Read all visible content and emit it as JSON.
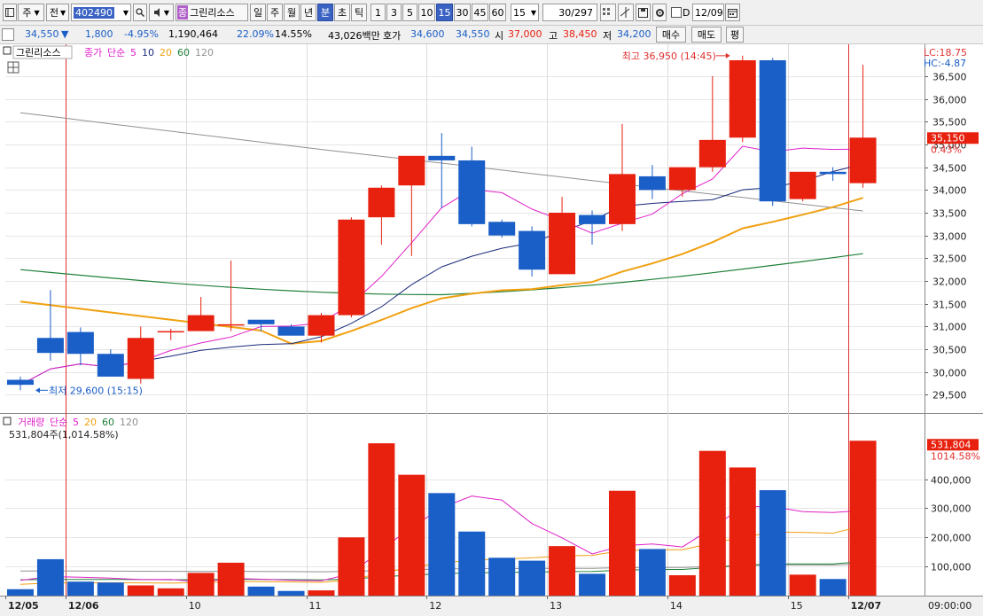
{
  "toolbar": {
    "btn_ju": "주",
    "btn_jeon": "전",
    "code_value": "402490",
    "stock_name": "그린리소스",
    "period_buttons": [
      "일",
      "주",
      "월",
      "년",
      "분",
      "초",
      "틱"
    ],
    "interval_buttons": [
      "1",
      "3",
      "5",
      "10",
      "15",
      "30",
      "45",
      "60"
    ],
    "interval_select": "15",
    "count": "30",
    "count_total": "/297",
    "d_label": "D",
    "date_value": "12/09"
  },
  "quote": {
    "price": "34,550",
    "arrow": "▼",
    "change": "1,800",
    "change_pct": "-4.95%",
    "volume": "1,190,464",
    "vol_ratio": "22.09%",
    "turnover": "14.55%",
    "amount": "43,026백만",
    "hoga_label": "호가",
    "ask": "34,600",
    "bid": "34,550",
    "open_label": "시",
    "open": "37,000",
    "high_label": "고",
    "high": "38,450",
    "low_label": "저",
    "low": "34,200",
    "buy_button": "매수",
    "sell_button": "매도",
    "eval_button": "평"
  },
  "colors": {
    "up": "#e8200e",
    "down": "#1a5ec8",
    "ma5": "#e020c8",
    "ma10": "#1a2a7a",
    "ma20": "#f0a010",
    "ma60": "#20803a",
    "ma120": "#909090"
  },
  "price_panel": {
    "legend_name": "그린리소스",
    "legend_items": [
      {
        "label": "종가",
        "color": "#e020c8"
      },
      {
        "label": "단순",
        "color": "#e020c8"
      },
      {
        "label": "5",
        "color": "#e020c8"
      },
      {
        "label": "10",
        "color": "#1a2a7a"
      },
      {
        "label": "20",
        "color": "#f0a010"
      },
      {
        "label": "60",
        "color": "#20803a"
      },
      {
        "label": "120",
        "color": "#909090"
      }
    ],
    "lc_label": "LC:18.75",
    "hc_label": "HC:-4.87",
    "high_annotation": "최고 36,950 (14:45)",
    "low_annotation": "최저 29,600 (15:15)",
    "current_price_tag": "35,150",
    "current_pct_tag": "0.43%"
  },
  "volume_panel": {
    "legend_items": [
      {
        "label": "거래량",
        "color": "#e020c8"
      },
      {
        "label": "단순",
        "color": "#e020c8"
      },
      {
        "label": "5",
        "color": "#e020c8"
      },
      {
        "label": "20",
        "color": "#f0a010"
      },
      {
        "label": "60",
        "color": "#20803a"
      },
      {
        "label": "120",
        "color": "#909090"
      }
    ],
    "current_text": "531,804주(1,014.58%)",
    "current_tag": "531,804",
    "current_pct_tag": "1014.58%"
  },
  "chart_data": {
    "type": "candlestick",
    "price_yticks": [
      29500,
      30000,
      30500,
      31000,
      31500,
      32000,
      32500,
      33000,
      33500,
      34000,
      34500,
      35000,
      35500,
      36000,
      36500
    ],
    "price_ylim": [
      29100,
      37200
    ],
    "volume_yticks": [
      100000,
      200000,
      300000,
      400000
    ],
    "volume_ylim": [
      0,
      560000
    ],
    "x_labels": [
      "12/05",
      "12/06",
      "10",
      "11",
      "12",
      "13",
      "14",
      "15",
      "12/07",
      "09:00:00"
    ],
    "candles": [
      {
        "o": 29830,
        "h": 29900,
        "l": 29600,
        "c": 29720,
        "v": 22000
      },
      {
        "o": 30750,
        "h": 31800,
        "l": 30250,
        "c": 30420,
        "v": 125000
      },
      {
        "o": 30880,
        "h": 30980,
        "l": 30150,
        "c": 30400,
        "v": 48000
      },
      {
        "o": 30400,
        "h": 30500,
        "l": 29900,
        "c": 29900,
        "v": 45000
      },
      {
        "o": 29850,
        "h": 31000,
        "l": 29750,
        "c": 30750,
        "v": 35000
      },
      {
        "o": 30900,
        "h": 30950,
        "l": 30700,
        "c": 30900,
        "v": 25000
      },
      {
        "o": 30900,
        "h": 31650,
        "l": 30900,
        "c": 31250,
        "v": 78000
      },
      {
        "o": 31050,
        "h": 32450,
        "l": 30900,
        "c": 31050,
        "v": 113000
      },
      {
        "o": 31150,
        "h": 31150,
        "l": 30900,
        "c": 31050,
        "v": 31000
      },
      {
        "o": 31000,
        "h": 31050,
        "l": 30800,
        "c": 30800,
        "v": 16000
      },
      {
        "o": 30800,
        "h": 31300,
        "l": 30650,
        "c": 31250,
        "v": 18000
      },
      {
        "o": 31250,
        "h": 33400,
        "l": 31200,
        "c": 33350,
        "v": 200000
      },
      {
        "o": 33400,
        "h": 34100,
        "l": 32800,
        "c": 34050,
        "v": 523000
      },
      {
        "o": 34100,
        "h": 34750,
        "l": 32550,
        "c": 34750,
        "v": 415000
      },
      {
        "o": 34750,
        "h": 35250,
        "l": 33600,
        "c": 34650,
        "v": 352000
      },
      {
        "o": 34650,
        "h": 34950,
        "l": 33200,
        "c": 33250,
        "v": 220000
      },
      {
        "o": 33300,
        "h": 33350,
        "l": 32950,
        "c": 33000,
        "v": 130000
      },
      {
        "o": 33100,
        "h": 33200,
        "l": 32100,
        "c": 32250,
        "v": 120000
      },
      {
        "o": 32150,
        "h": 33850,
        "l": 32150,
        "c": 33500,
        "v": 170000
      },
      {
        "o": 33450,
        "h": 33550,
        "l": 32800,
        "c": 33250,
        "v": 75000
      },
      {
        "o": 33250,
        "h": 35450,
        "l": 33100,
        "c": 34350,
        "v": 360000
      },
      {
        "o": 34300,
        "h": 34550,
        "l": 33800,
        "c": 34000,
        "v": 160000
      },
      {
        "o": 34000,
        "h": 34500,
        "l": 33850,
        "c": 34500,
        "v": 70000
      },
      {
        "o": 34500,
        "h": 36500,
        "l": 34400,
        "c": 35100,
        "v": 497000
      },
      {
        "o": 35150,
        "h": 36950,
        "l": 35050,
        "c": 36850,
        "v": 440000
      },
      {
        "o": 36850,
        "h": 36900,
        "l": 33650,
        "c": 33750,
        "v": 362000
      },
      {
        "o": 33800,
        "h": 34400,
        "l": 33750,
        "c": 34400,
        "v": 72000
      },
      {
        "o": 34400,
        "h": 34500,
        "l": 34200,
        "c": 34350,
        "v": 57000
      },
      {
        "o": 34150,
        "h": 36750,
        "l": 34050,
        "c": 35150,
        "v": 531804
      }
    ]
  }
}
